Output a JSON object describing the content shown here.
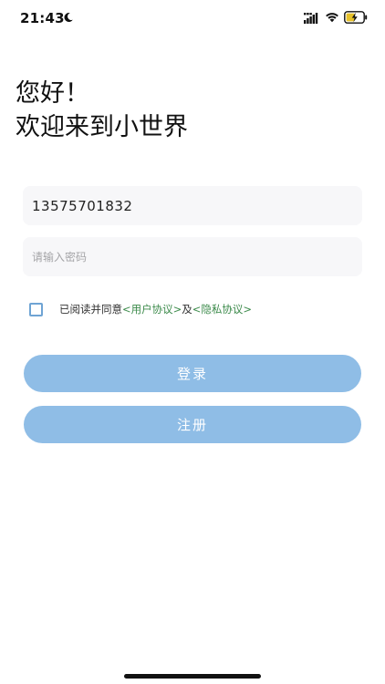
{
  "status_bar": {
    "time": "21:43",
    "icons": [
      "moon-icon",
      "signal-icon",
      "wifi-icon",
      "battery-charging-icon"
    ]
  },
  "greeting": {
    "line1": "您好！",
    "line2": "欢迎来到小世界"
  },
  "form": {
    "phone_value": "13575701832",
    "password_placeholder": "请输入密码"
  },
  "agreement": {
    "text": "已阅读并同意",
    "user_agreement": "<用户协议>",
    "conjunction": "及",
    "privacy_agreement": "<隐私协议>"
  },
  "buttons": {
    "login": "登录",
    "register": "注册"
  },
  "colors": {
    "button_bg": "#8fbde6",
    "link": "#3b8a4a",
    "checkbox_border": "#6fa4d4",
    "field_bg": "#f7f7f9"
  }
}
